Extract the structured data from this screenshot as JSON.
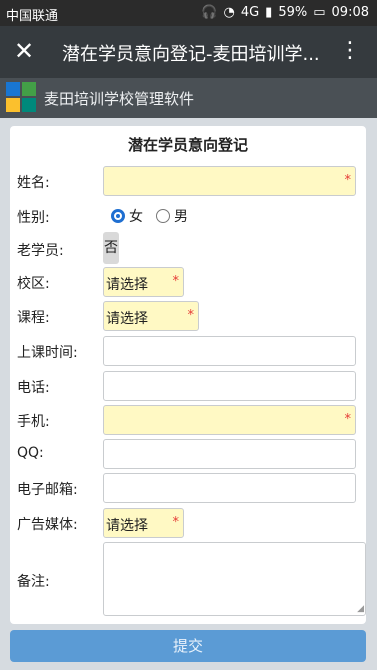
{
  "status": {
    "carrier": "中国联通",
    "network": "4G",
    "battery": "59%",
    "time": "09:08"
  },
  "appbar": {
    "title": "潜在学员意向登记-麦田培训学...",
    "close_icon": "close-icon",
    "more_icon": "more-vert-icon"
  },
  "brand": {
    "name": "麦田培训学校管理软件",
    "colors": [
      "#1976d2",
      "#43a047",
      "#fbc02d",
      "#00897b"
    ]
  },
  "form": {
    "title": "潜在学员意向登记",
    "labels": {
      "name": "姓名:",
      "gender": "性别:",
      "old": "老学员:",
      "campus": "校区:",
      "course": "课程:",
      "class_time": "上课时间:",
      "phone": "电话:",
      "mobile": "手机:",
      "qq": "QQ:",
      "email": "电子邮箱:",
      "media": "广告媒体:",
      "remark": "备注:"
    },
    "gender_options": {
      "female": "女",
      "male": "男",
      "selected": "女"
    },
    "old_value": "否",
    "campus_value": "请选择",
    "course_value": "请选择",
    "media_value": "请选择",
    "required_mark": "*",
    "submit": "提交"
  },
  "colors": {
    "required_bg": "#fff9c4",
    "accent": "#1f6fd1",
    "submit_bg": "#5b9bd5"
  }
}
